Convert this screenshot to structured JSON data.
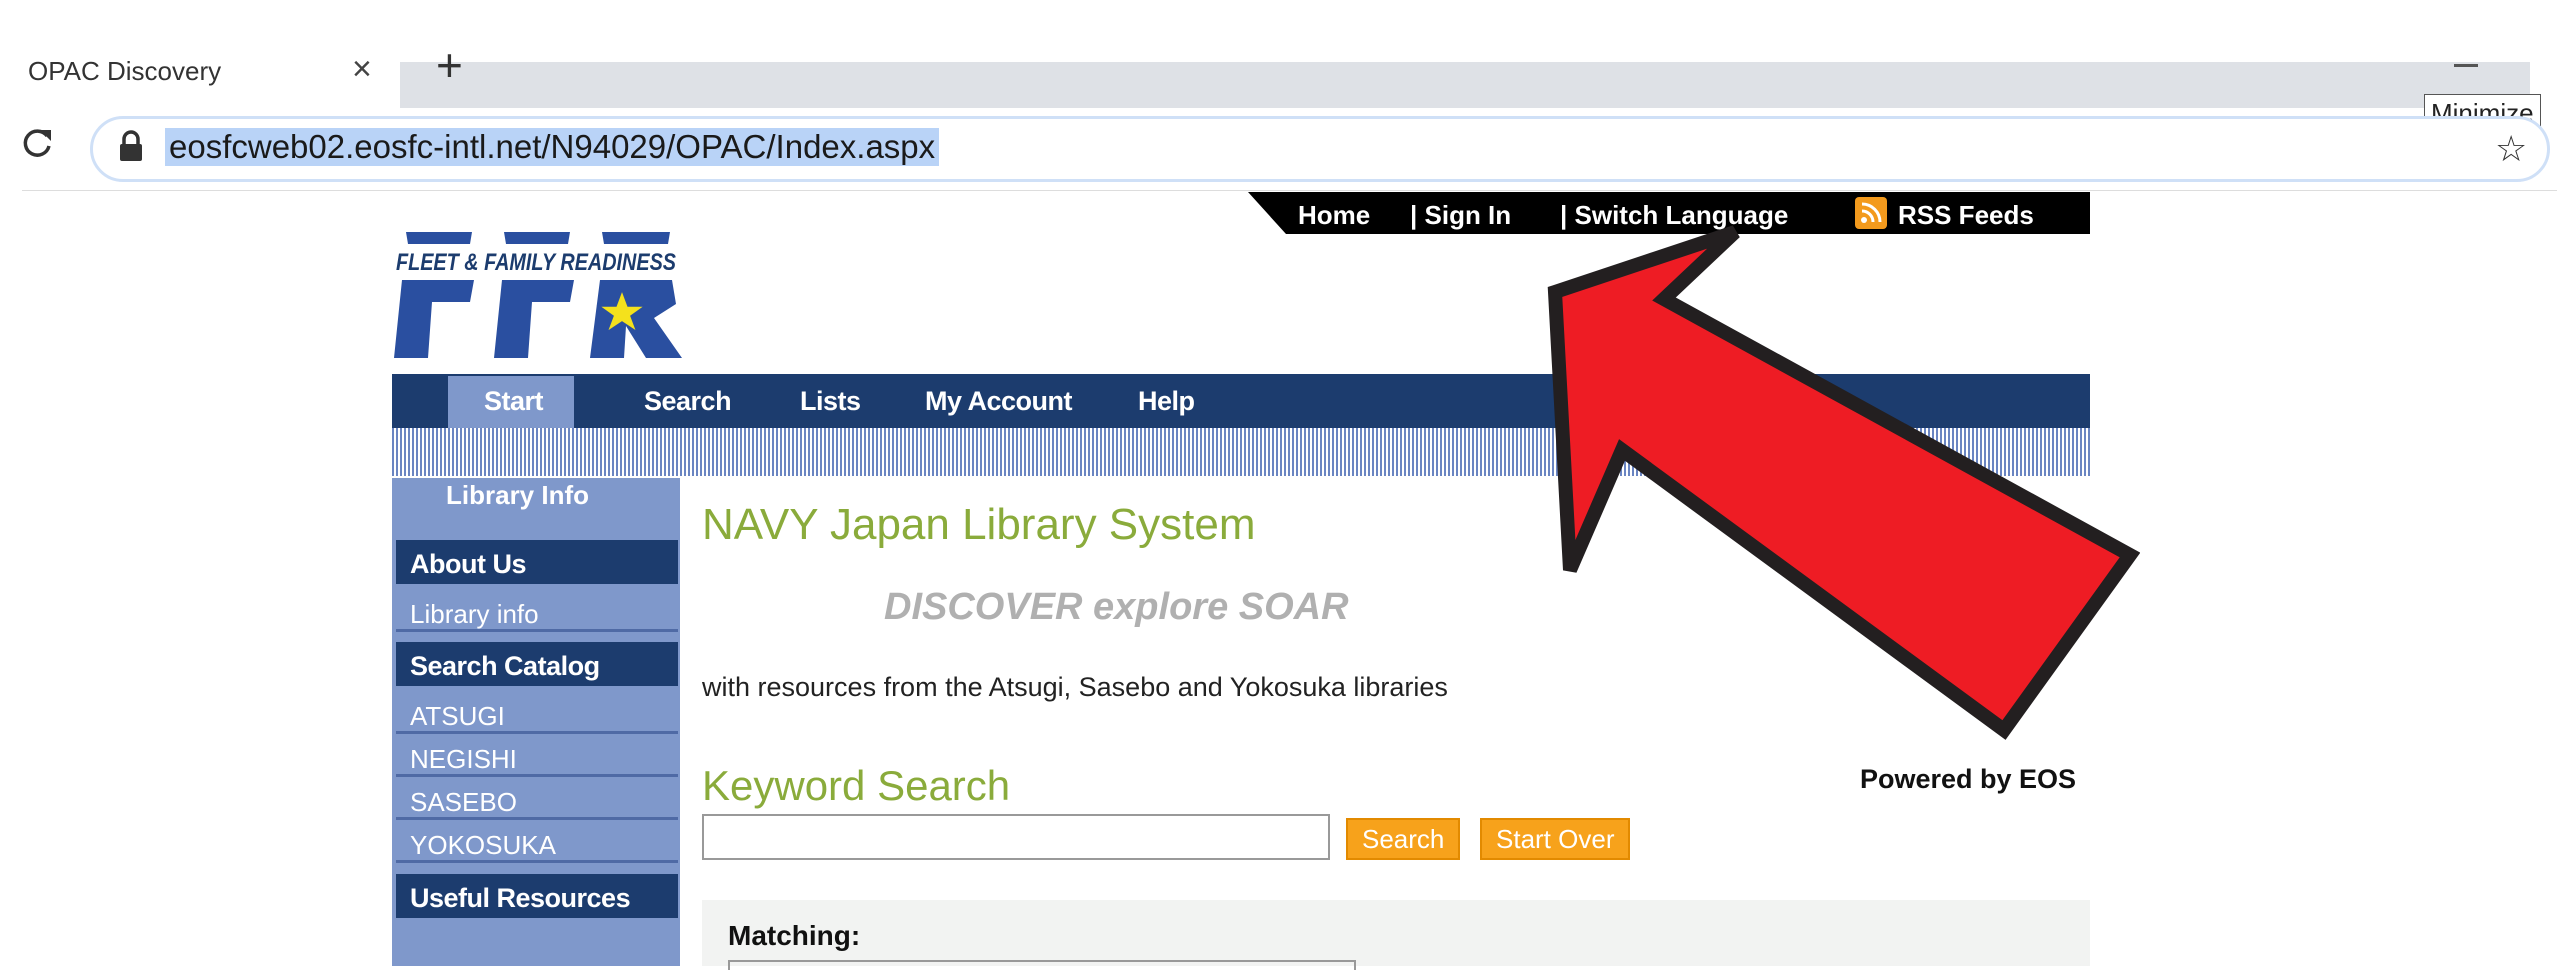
{
  "browser": {
    "tab_title": "OPAC Discovery",
    "tab_close": "×",
    "new_tab": "+",
    "url": "eosfcweb02.eosfc-intl.net/N94029/OPAC/Index.aspx",
    "tooltip": "Minimize",
    "star": "☆"
  },
  "topbar": {
    "home": "Home",
    "sign_in": "| Sign In",
    "switch_language": "| Switch Language",
    "rss_feeds": "RSS Feeds"
  },
  "logo": {
    "text": "FLEET & FAMILY READINESS",
    "letters": "FFR"
  },
  "nav": {
    "items": [
      "Start",
      "Search",
      "Lists",
      "My Account",
      "Help"
    ]
  },
  "sidebar": {
    "header": "Library Info",
    "about_us": "About Us",
    "library_info": "Library info",
    "search_catalog": "Search Catalog",
    "libraries": [
      "ATSUGI",
      "NEGISHI",
      "SASEBO",
      "YOKOSUKA"
    ],
    "useful_resources": "Useful Resources"
  },
  "main": {
    "title": "NAVY Japan Library System",
    "tagline": "DISCOVER explore SOAR",
    "description": "with resources from the Atsugi, Sasebo and Yokosuka libraries",
    "keyword_search": "Keyword Search",
    "powered_by": "Powered by EOS",
    "search_value": "",
    "search_button": "Search",
    "start_over_button": "Start Over",
    "matching_label": "Matching:"
  },
  "colors": {
    "nav": "#1c3c6e",
    "sidebar": "#7f98cb",
    "accent_green": "#8aab3b",
    "button_orange": "#f7a21b",
    "arrow_red": "#ee1c24"
  }
}
